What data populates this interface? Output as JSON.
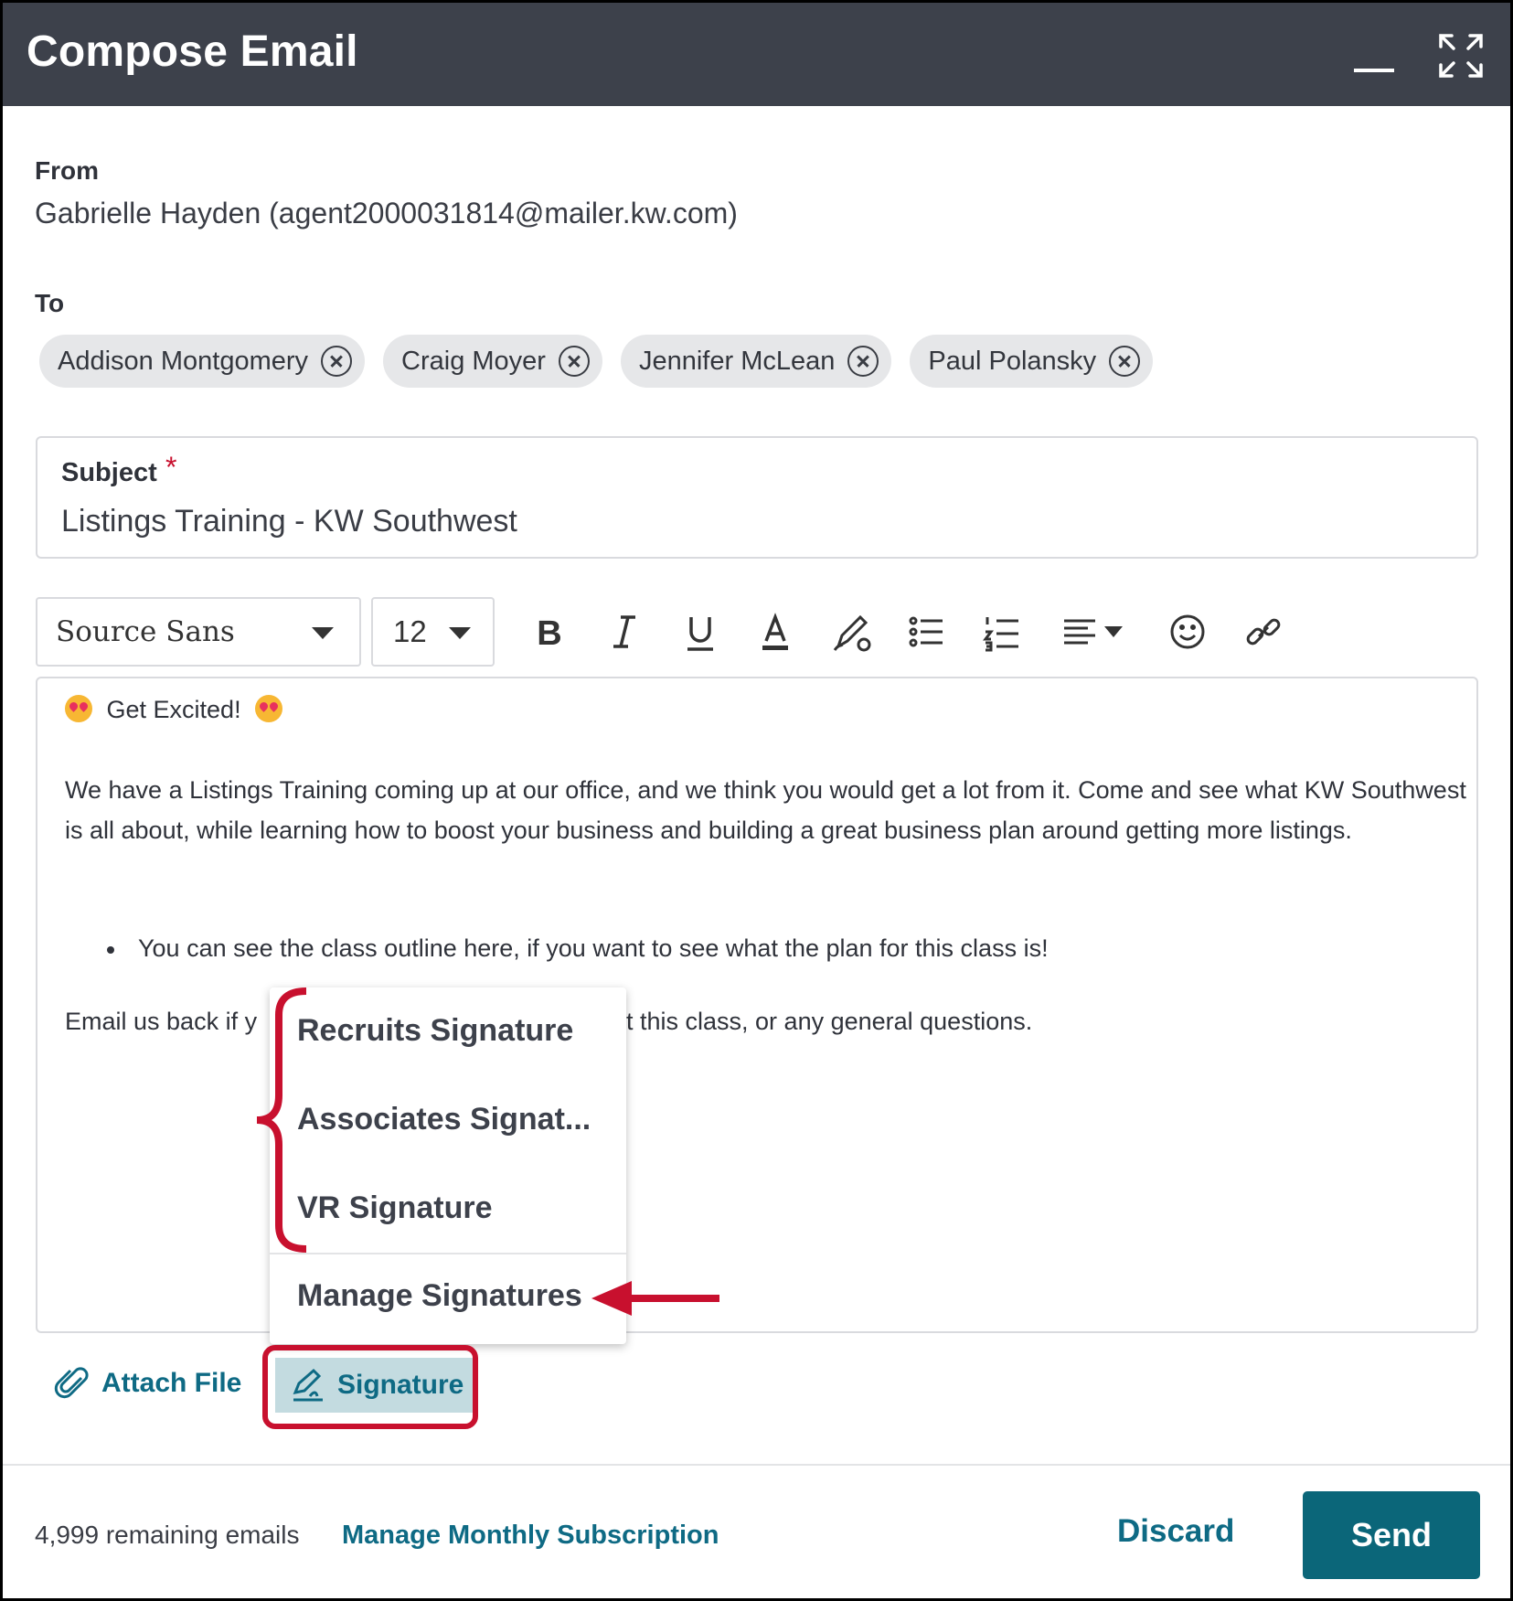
{
  "window": {
    "title": "Compose Email"
  },
  "from": {
    "label": "From",
    "value": "Gabrielle Hayden (agent2000031814@mailer.kw.com)"
  },
  "to": {
    "label": "To",
    "recipients": [
      "Addison Montgomery",
      "Craig Moyer",
      "Jennifer McLean",
      "Paul Polansky"
    ]
  },
  "subject": {
    "label": "Subject",
    "required_marker": "*",
    "value": "Listings Training - KW Southwest"
  },
  "toolbar": {
    "font": "Source Sans",
    "size": "12",
    "icons": [
      "bold-icon",
      "italic-icon",
      "underline-icon",
      "text-color-icon",
      "highlight-icon",
      "bullet-list-icon",
      "numbered-list-icon",
      "align-icon",
      "emoji-icon",
      "link-icon"
    ]
  },
  "body": {
    "greeting": "Get Excited!",
    "paragraph": "We have a Listings Training coming up at our office, and we think you would get a lot from it. Come and see what KW Southwest is all about, while learning how to boost your business and building a great business plan around getting more listings.",
    "bullet": "You can see the class outline here, if you want to see what the plan for this class is!",
    "closing_start": "Email us back if y",
    "closing_end": "t this class, or any general questions."
  },
  "signature_menu": {
    "items": [
      "Recruits Signature",
      "Associates Signat...",
      "VR Signature"
    ],
    "manage": "Manage Signatures"
  },
  "actions": {
    "attach": "Attach File",
    "signature": "Signature"
  },
  "footer": {
    "remaining": "4,999 remaining emails",
    "manage_subscription": "Manage Monthly Subscription",
    "discard": "Discard",
    "send": "Send"
  },
  "colors": {
    "header": "#3d414b",
    "accent": "#0e6a84",
    "annotation": "#c8102e"
  }
}
